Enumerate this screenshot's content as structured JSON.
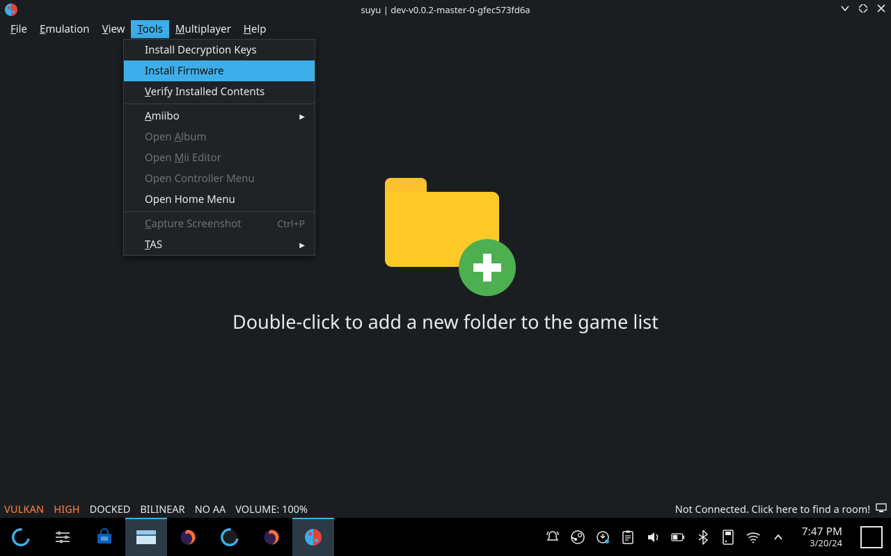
{
  "title": "suyu | dev-v0.0.2-master-0-gfec573fd6a",
  "menubar": [
    {
      "label": "File",
      "mnemonic_index": 0
    },
    {
      "label": "Emulation",
      "mnemonic_index": 0
    },
    {
      "label": "View",
      "mnemonic_index": 0
    },
    {
      "label": "Tools",
      "mnemonic_index": 0,
      "active": true
    },
    {
      "label": "Multiplayer",
      "mnemonic_index": 0
    },
    {
      "label": "Help",
      "mnemonic_index": 0
    }
  ],
  "tools_menu": [
    {
      "label": "Install Decryption Keys"
    },
    {
      "label": "Install Firmware",
      "highlight": true
    },
    {
      "label": "Verify Installed Contents",
      "mnemonic_index": 0
    },
    {
      "separator": true
    },
    {
      "label": "Amiibo",
      "mnemonic_index": 0,
      "submenu": true
    },
    {
      "label": "Open Album",
      "mnemonic_index": 5,
      "disabled": true
    },
    {
      "label": "Open Mii Editor",
      "mnemonic_index": 5,
      "disabled": true
    },
    {
      "label": "Open Controller Menu",
      "disabled": true
    },
    {
      "label": "Open Home Menu"
    },
    {
      "separator": true
    },
    {
      "label": "Capture Screenshot",
      "mnemonic_index": 0,
      "disabled": true,
      "shortcut": "Ctrl+P"
    },
    {
      "label": "TAS",
      "mnemonic_index": 0,
      "submenu": true
    }
  ],
  "main": {
    "prompt": "Double-click to add a new folder to the game list"
  },
  "statusbar": {
    "vulkan": "VULKAN",
    "high": "HIGH",
    "docked": "DOCKED",
    "filter": "BILINEAR",
    "aa": "NO AA",
    "volume": "VOLUME: 100%",
    "room": "Not Connected. Click here to find a room!"
  },
  "clock": {
    "time": "7:47 PM",
    "date": "3/20/24"
  }
}
